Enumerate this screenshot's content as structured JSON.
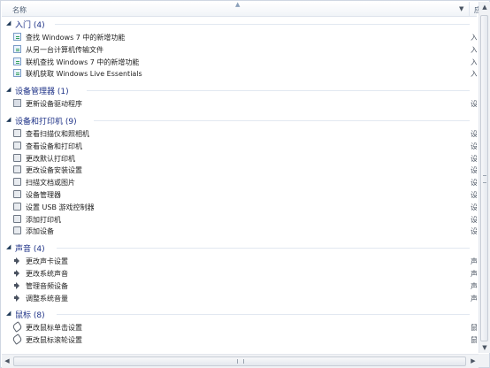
{
  "header": {
    "name_label": "名称",
    "app_label": "应用"
  },
  "groups": [
    {
      "title": "入门 (4)",
      "items": [
        {
          "label": "查找 Windows 7 中的新增功能",
          "category": "入门"
        },
        {
          "label": "从另一台计算机传输文件",
          "category": "入门"
        },
        {
          "label": "联机查找 Windows 7 中的新增功能",
          "category": "入门"
        },
        {
          "label": "联机获取 Windows Live Essentials",
          "category": "入门"
        }
      ]
    },
    {
      "title": "设备管理器 (1)",
      "items": [
        {
          "label": "更新设备驱动程序",
          "category": "设备"
        }
      ]
    },
    {
      "title": "设备和打印机 (9)",
      "items": [
        {
          "label": "查看扫描仪和照相机",
          "category": "设备"
        },
        {
          "label": "查看设备和打印机",
          "category": "设备"
        },
        {
          "label": "更改默认打印机",
          "category": "设备"
        },
        {
          "label": "更改设备安装设置",
          "category": "设备"
        },
        {
          "label": "扫描文档或图片",
          "category": "设备"
        },
        {
          "label": "设备管理器",
          "category": "设备"
        },
        {
          "label": "设置 USB 游戏控制器",
          "category": "设备"
        },
        {
          "label": "添加打印机",
          "category": "设备"
        },
        {
          "label": "添加设备",
          "category": "设备"
        }
      ]
    },
    {
      "title": "声音 (4)",
      "items": [
        {
          "label": "更改声卡设置",
          "category": "声音"
        },
        {
          "label": "更改系统声音",
          "category": "声音"
        },
        {
          "label": "管理音频设备",
          "category": "声音"
        },
        {
          "label": "调整系统音量",
          "category": "声音"
        }
      ]
    },
    {
      "title": "鼠标 (8)",
      "items": [
        {
          "label": "更改鼠标单击设置",
          "category": "鼠标"
        },
        {
          "label": "更改鼠标滚轮设置",
          "category": "鼠标"
        }
      ]
    }
  ],
  "icons": {
    "sort": "sort-ascending-icon",
    "dropdown": "column-dropdown-icon",
    "group_toggle": "group-collapse-icon"
  }
}
